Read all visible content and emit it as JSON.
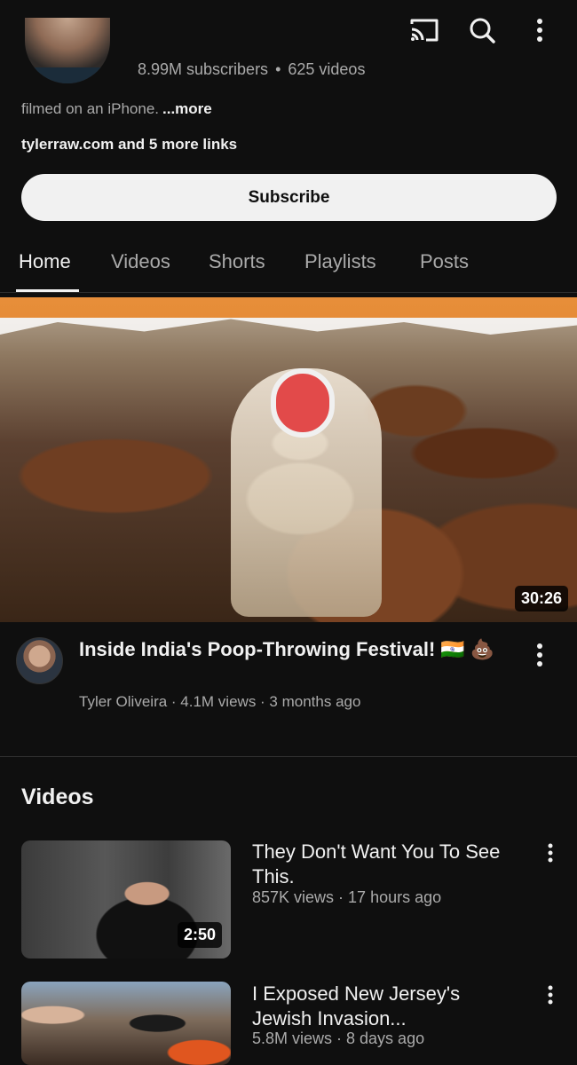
{
  "topbar": {
    "icons": [
      "chevron-left-icon",
      "cast-icon",
      "search-icon",
      "more-vertical-icon"
    ]
  },
  "channel": {
    "subscribers": "8.99M subscribers",
    "videos_count": "625 videos",
    "description": "filmed on an iPhone.",
    "description_more": "...more",
    "links": "tylerraw.com and 5 more links",
    "subscribe_label": "Subscribe"
  },
  "tabs": [
    {
      "label": "Home",
      "active": true
    },
    {
      "label": "Videos",
      "active": false
    },
    {
      "label": "Shorts",
      "active": false
    },
    {
      "label": "Playlists",
      "active": false
    },
    {
      "label": "Posts",
      "active": false
    }
  ],
  "featured": {
    "duration": "30:26",
    "title": "Inside India's Poop-Throwing Festival! 🇮🇳 💩",
    "meta": "Tyler Oliveira · 4.1M views · 3 months ago"
  },
  "videos_section": {
    "title": "Videos",
    "items": [
      {
        "title": "They Don't Want You To See This.",
        "meta": "857K views · 17 hours ago",
        "duration": "2:50"
      },
      {
        "title": "I Exposed New Jersey's Jewish Invasion...",
        "meta": "5.8M views · 8 days ago",
        "duration": ""
      }
    ]
  },
  "colors": {
    "background": "#0f0f0f",
    "text_primary": "#f1f1f1",
    "text_secondary": "#aaaaaa",
    "subscribe_bg": "#f1f1f1"
  }
}
